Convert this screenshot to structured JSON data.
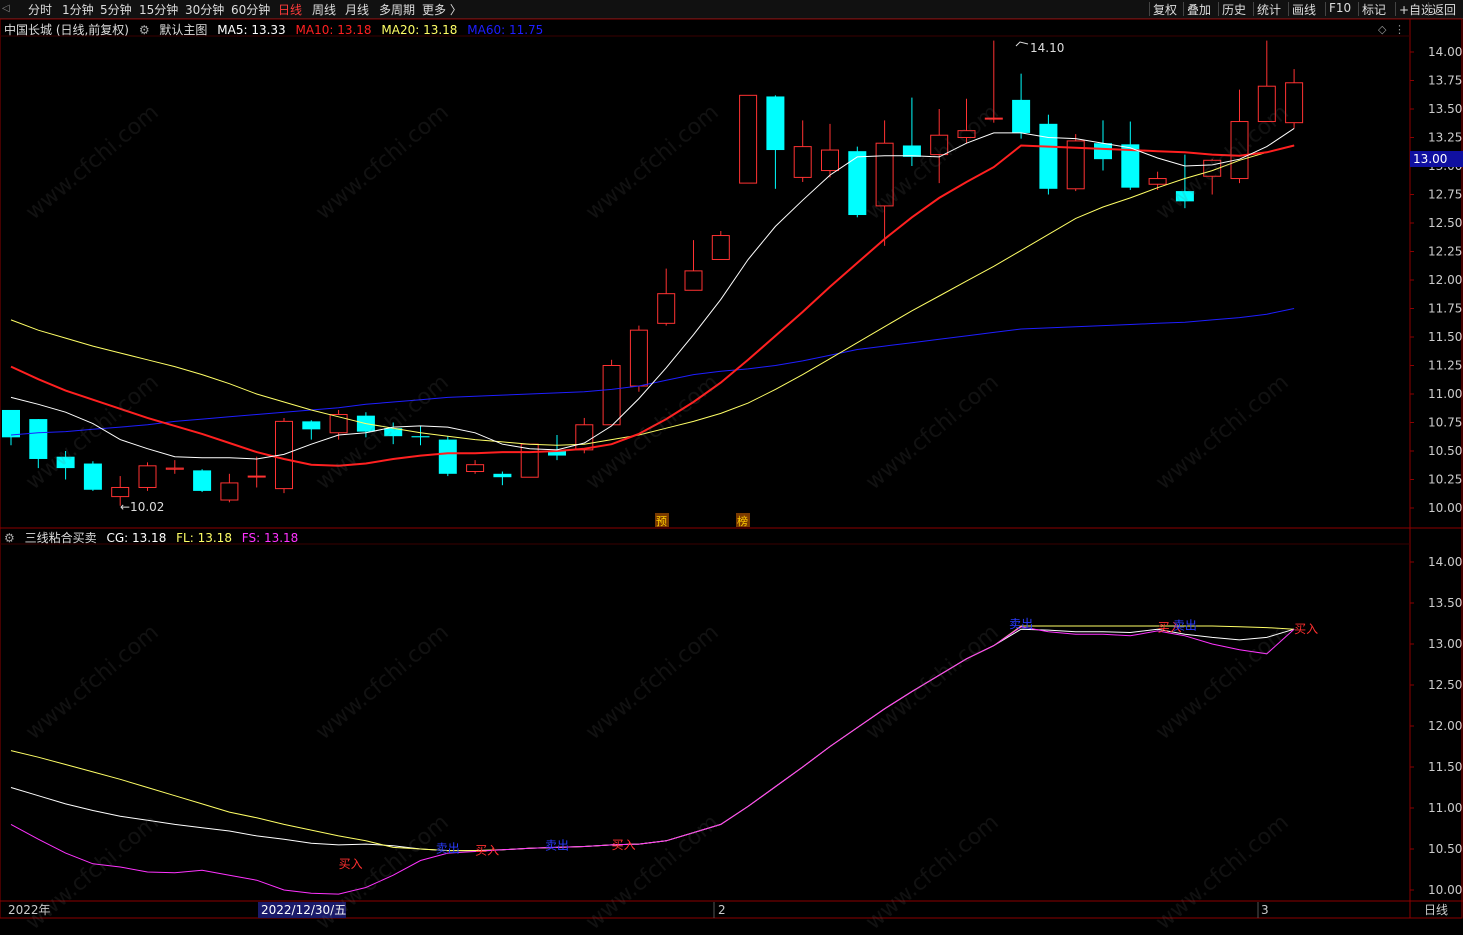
{
  "toolbar": {
    "left": [
      "分时",
      "1分钟",
      "5分钟",
      "15分钟",
      "30分钟",
      "60分钟",
      "日线",
      "周线",
      "月线",
      "多周期",
      "更多 〉"
    ],
    "active": "日线",
    "right": [
      "复权",
      "叠加",
      "历史",
      "统计",
      "画线",
      "F10",
      "标记",
      "+自选",
      "返回"
    ]
  },
  "main_info": {
    "stock": "中国长城 (日线,前复权)",
    "template": "默认主图",
    "ma5": "MA5: 13.33",
    "ma10": "MA10: 13.18",
    "ma20": "MA20: 13.18",
    "ma60": "MA60: 11.75"
  },
  "sub_info": {
    "name": "三线粘合买卖",
    "cg": "CG: 13.18",
    "fl": "FL: 13.18",
    "fs": "FS: 13.18"
  },
  "colors": {
    "up": "#ff3232",
    "down": "#00ffff",
    "ma5": "#ffffff",
    "ma10": "#ff2020",
    "ma20": "#ffff66",
    "ma60": "#1e1eff",
    "cg": "#ffffff",
    "fl": "#ffff66",
    "fs": "#ff33ff",
    "axis": "#8b0000",
    "axis_text": "#cccccc",
    "price_tag": "#1010a0"
  },
  "chart_data": [
    {
      "type": "candlestick",
      "title": "中国长城 (日线,前复权)",
      "ylim": [
        10.0,
        14.1
      ],
      "yticks": [
        "14.00",
        "13.75",
        "13.50",
        "13.25",
        "13.00",
        "12.75",
        "12.50",
        "12.25",
        "12.00",
        "11.75",
        "11.50",
        "11.25",
        "11.00",
        "10.75",
        "10.50",
        "10.25",
        "10.00"
      ],
      "candles": [
        [
          10.86,
          10.8,
          10.62,
          10.55
        ],
        [
          10.78,
          10.78,
          10.43,
          10.35
        ],
        [
          10.45,
          10.5,
          10.35,
          10.25
        ],
        [
          10.39,
          10.41,
          10.16,
          10.15
        ],
        [
          10.1,
          10.28,
          10.18,
          10.02
        ],
        [
          10.18,
          10.4,
          10.37,
          10.15
        ],
        [
          10.34,
          10.42,
          10.35,
          10.3
        ],
        [
          10.33,
          10.34,
          10.15,
          10.14
        ],
        [
          10.07,
          10.3,
          10.22,
          10.05
        ],
        [
          10.28,
          10.45,
          10.28,
          10.18
        ],
        [
          10.17,
          10.79,
          10.76,
          10.13
        ],
        [
          10.76,
          10.77,
          10.69,
          10.6
        ],
        [
          10.66,
          10.86,
          10.82,
          10.6
        ],
        [
          10.81,
          10.84,
          10.67,
          10.62
        ],
        [
          10.7,
          10.75,
          10.63,
          10.56
        ],
        [
          10.63,
          10.72,
          10.62,
          10.55
        ],
        [
          10.6,
          10.63,
          10.3,
          10.28
        ],
        [
          10.32,
          10.42,
          10.38,
          10.3
        ],
        [
          10.3,
          10.32,
          10.27,
          10.2
        ],
        [
          10.27,
          10.56,
          10.56,
          10.27
        ],
        [
          10.5,
          10.64,
          10.46,
          10.42
        ],
        [
          10.51,
          10.79,
          10.73,
          10.48
        ],
        [
          10.73,
          11.3,
          11.25,
          10.73
        ],
        [
          11.07,
          11.6,
          11.56,
          11.02
        ],
        [
          11.62,
          12.1,
          11.88,
          11.6
        ],
        [
          11.91,
          12.35,
          12.08,
          11.92
        ],
        [
          12.18,
          12.43,
          12.39,
          12.18
        ],
        [
          12.85,
          13.62,
          13.62,
          12.85
        ],
        [
          13.61,
          13.62,
          13.14,
          12.8
        ],
        [
          12.9,
          13.4,
          13.17,
          12.86
        ],
        [
          12.96,
          13.37,
          13.14,
          12.9
        ],
        [
          13.13,
          13.17,
          12.57,
          12.55
        ],
        [
          12.65,
          13.4,
          13.2,
          12.3
        ],
        [
          13.18,
          13.6,
          13.08,
          13.0
        ],
        [
          13.1,
          13.5,
          13.27,
          12.85
        ],
        [
          13.25,
          13.59,
          13.31,
          13.2
        ],
        [
          13.42,
          14.1,
          13.42,
          13.38
        ],
        [
          13.58,
          13.81,
          13.29,
          13.24
        ],
        [
          13.37,
          13.45,
          12.8,
          12.75
        ],
        [
          12.8,
          13.28,
          13.22,
          12.78
        ],
        [
          13.2,
          13.4,
          13.06,
          12.96
        ],
        [
          13.19,
          13.39,
          12.81,
          12.79
        ],
        [
          12.84,
          12.95,
          12.89,
          12.79
        ],
        [
          12.78,
          13.1,
          12.69,
          12.63
        ],
        [
          12.91,
          13.06,
          13.05,
          12.75
        ],
        [
          12.89,
          13.67,
          13.39,
          12.85
        ],
        [
          13.39,
          14.1,
          13.7,
          13.39
        ],
        [
          13.38,
          13.85,
          13.73,
          13.33
        ]
      ],
      "ma5": [
        10.97,
        10.91,
        10.84,
        10.74,
        10.6,
        10.52,
        10.45,
        10.44,
        10.44,
        10.43,
        10.47,
        10.56,
        10.64,
        10.66,
        10.71,
        10.72,
        10.71,
        10.66,
        10.56,
        10.52,
        10.51,
        10.57,
        10.72,
        10.96,
        11.23,
        11.52,
        11.83,
        12.18,
        12.47,
        12.7,
        12.92,
        13.08,
        13.09,
        13.09,
        13.08,
        13.2,
        13.29,
        13.29,
        13.25,
        13.24,
        13.2,
        13.16,
        13.07,
        13.0,
        13.01,
        13.06,
        13.17,
        13.33
      ],
      "ma10": [
        11.24,
        11.13,
        11.03,
        10.95,
        10.87,
        10.79,
        10.72,
        10.65,
        10.57,
        10.49,
        10.43,
        10.38,
        10.37,
        10.39,
        10.43,
        10.46,
        10.48,
        10.48,
        10.49,
        10.49,
        10.5,
        10.52,
        10.56,
        10.65,
        10.78,
        10.93,
        11.1,
        11.3,
        11.51,
        11.72,
        11.94,
        12.15,
        12.36,
        12.55,
        12.72,
        12.86,
        12.99,
        13.18,
        13.17,
        13.16,
        13.15,
        13.14,
        13.13,
        13.12,
        13.1,
        13.09,
        13.12,
        13.18
      ],
      "ma20": [
        11.65,
        11.56,
        11.49,
        11.42,
        11.36,
        11.3,
        11.24,
        11.17,
        11.09,
        11.0,
        10.93,
        10.86,
        10.8,
        10.74,
        10.7,
        10.66,
        10.63,
        10.6,
        10.58,
        10.56,
        10.55,
        10.56,
        10.6,
        10.64,
        10.7,
        10.76,
        10.83,
        10.92,
        11.04,
        11.17,
        11.31,
        11.45,
        11.59,
        11.73,
        11.86,
        11.99,
        12.12,
        12.26,
        12.4,
        12.54,
        12.64,
        12.72,
        12.81,
        12.89,
        12.96,
        13.05,
        13.12,
        13.18
      ],
      "ma60": [
        10.64,
        10.66,
        10.67,
        10.69,
        10.71,
        10.73,
        10.76,
        10.78,
        10.8,
        10.82,
        10.84,
        10.86,
        10.88,
        10.91,
        10.93,
        10.95,
        10.97,
        10.98,
        10.99,
        11.0,
        11.01,
        11.02,
        11.04,
        11.07,
        11.12,
        11.17,
        11.2,
        11.22,
        11.25,
        11.29,
        11.34,
        11.39,
        11.42,
        11.45,
        11.48,
        11.51,
        11.54,
        11.57,
        11.58,
        11.59,
        11.6,
        11.61,
        11.62,
        11.63,
        11.65,
        11.67,
        11.7,
        11.75
      ],
      "annotations": [
        "14.10",
        "10.02",
        "13.00",
        "预",
        "榜"
      ]
    },
    {
      "type": "line",
      "title": "三线粘合买卖",
      "ylim": [
        9.95,
        14.45
      ],
      "yticks": [
        "14.00",
        "13.50",
        "13.00",
        "12.50",
        "12.00",
        "11.50",
        "11.00",
        "10.50",
        "10.00"
      ],
      "series": [
        {
          "name": "CG",
          "values": [
            11.25,
            11.15,
            11.05,
            10.97,
            10.9,
            10.85,
            10.8,
            10.76,
            10.72,
            10.66,
            10.62,
            10.57,
            10.55,
            10.56,
            10.54,
            10.5,
            10.48,
            10.48,
            10.49,
            10.51,
            10.52,
            10.53,
            10.55,
            10.56,
            10.6,
            10.7,
            10.8,
            11.02,
            11.26,
            11.5,
            11.75,
            11.98,
            12.21,
            12.42,
            12.62,
            12.82,
            12.98,
            13.18,
            13.17,
            13.15,
            13.15,
            13.14,
            13.18,
            13.12,
            13.08,
            13.05,
            13.08,
            13.18
          ]
        },
        {
          "name": "FL",
          "values": [
            11.7,
            11.62,
            11.53,
            11.44,
            11.35,
            11.25,
            11.15,
            11.05,
            10.95,
            10.88,
            10.8,
            10.73,
            10.66,
            10.6,
            10.52,
            10.5,
            10.48,
            10.48,
            10.49,
            10.51,
            10.52,
            10.53,
            10.55,
            10.56,
            10.6,
            10.7,
            10.8,
            11.02,
            11.26,
            11.5,
            11.75,
            11.98,
            12.21,
            12.42,
            12.62,
            12.82,
            12.98,
            13.22,
            13.22,
            13.22,
            13.22,
            13.22,
            13.22,
            13.22,
            13.22,
            13.21,
            13.2,
            13.18
          ]
        },
        {
          "name": "FS",
          "values": [
            10.8,
            10.62,
            10.45,
            10.32,
            10.28,
            10.22,
            10.21,
            10.24,
            10.18,
            10.12,
            10.0,
            9.96,
            9.95,
            10.03,
            10.18,
            10.36,
            10.45,
            10.47,
            10.49,
            10.51,
            10.52,
            10.53,
            10.55,
            10.56,
            10.6,
            10.7,
            10.8,
            11.02,
            11.26,
            11.5,
            11.75,
            11.98,
            12.21,
            12.42,
            12.62,
            12.82,
            12.98,
            13.21,
            13.15,
            13.12,
            13.12,
            13.1,
            13.16,
            13.1,
            13.0,
            12.93,
            12.88,
            13.18
          ]
        }
      ],
      "signals": [
        {
          "label": "买入",
          "index": 12,
          "value": 10.32
        },
        {
          "label": "卖出",
          "index": 16,
          "value": 10.48
        },
        {
          "label": "买入",
          "index": 17,
          "value": 10.48
        },
        {
          "label": "卖出",
          "index": 20,
          "value": 10.52
        },
        {
          "label": "买入",
          "index": 22,
          "value": 10.55
        },
        {
          "label": "卖出",
          "index": 37,
          "value": 13.22
        },
        {
          "label": "买入",
          "index": 42,
          "value": 13.2
        },
        {
          "label": "卖出",
          "index": 43,
          "value": 13.2
        },
        {
          "label": "买入",
          "index": 47,
          "value": 13.18
        }
      ]
    }
  ],
  "x_axis": {
    "labels": [
      "2022年",
      "2022/12/30/五",
      "2",
      "3",
      "日线"
    ]
  },
  "watermark": "www.cfchi.com"
}
